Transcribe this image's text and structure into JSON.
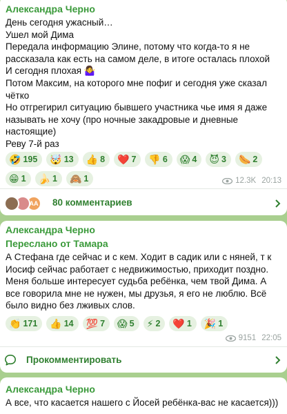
{
  "messages": [
    {
      "author": "Александра Черно",
      "text": "День сегодня ужасный…\nУшел мой Дима\nПередала информацию Элине, потому что когда-то я не рассказала как есть на самом деле, в итоге осталась плохой\nИ сегодня плохая 🤷‍♀️\nПотом Максим, на которого мне пофиг и сегодня уже сказал чётко\nНо отгрегирил ситуацию бывшего участника чье имя я даже называть не хочу (про ночные закадровые и дневные настоящие)\nРеву 7-й раз",
      "reactions": [
        {
          "emoji": "🤣",
          "count": "195"
        },
        {
          "emoji": "🤯",
          "count": "13"
        },
        {
          "emoji": "👍",
          "count": "8"
        },
        {
          "emoji": "❤️",
          "count": "7"
        },
        {
          "emoji": "👎",
          "count": "6"
        },
        {
          "emoji": "😱",
          "count": "4"
        },
        {
          "emoji": "😈",
          "count": "3"
        },
        {
          "emoji": "🌭",
          "count": "2"
        },
        {
          "emoji": "😁",
          "count": "1"
        },
        {
          "emoji": "🍌",
          "count": "1"
        },
        {
          "emoji": "🙈",
          "count": "1"
        }
      ],
      "views": "12.3K",
      "time": "20:13",
      "comments_label": "80 комментариев",
      "avatar_initials": "АА"
    },
    {
      "author": "Александра Черно",
      "forwarded": "Переслано от Тамара",
      "text": "А Стефана где сейчас и с кем. Ходит в садик или с няней, т к Иосиф сейчас работает с недвижимостью, приходит поздно. Меня больше интересует судьба ребёнка, чем твой Дима. А все говорила мне не нужен, мы друзья, я его не люблю. Всё было видно без лживых слов.",
      "reactions": [
        {
          "emoji": "👏",
          "count": "171"
        },
        {
          "emoji": "👍",
          "count": "14"
        },
        {
          "emoji": "💯",
          "count": "7"
        },
        {
          "emoji": "😱",
          "count": "5"
        },
        {
          "emoji": "⚡",
          "count": "2"
        },
        {
          "emoji": "❤️",
          "count": "1"
        },
        {
          "emoji": "🎉",
          "count": "1"
        }
      ],
      "views": "9151",
      "time": "22:05",
      "comments_label": "Прокомментировать"
    },
    {
      "author": "Александра Черно",
      "text": "А все, что касается нашего с Йосей ребёнка-вас не касается)))"
    }
  ],
  "colors": {
    "accent": "#2f7f2f",
    "background": "#a9cf8f",
    "reaction_bg": "#e6f1e1"
  }
}
